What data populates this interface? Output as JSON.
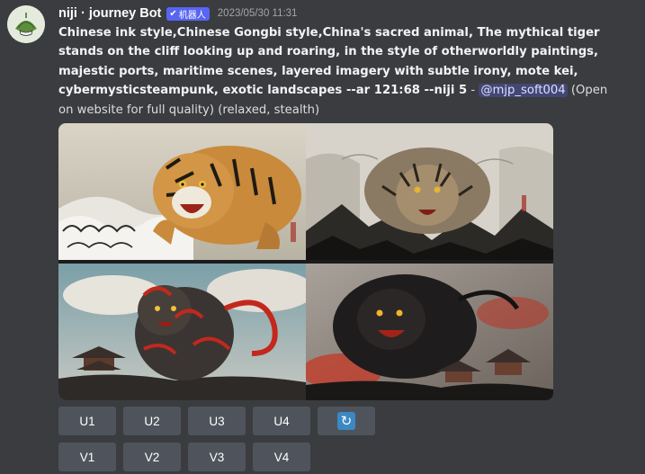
{
  "author": {
    "name": "niji · journey Bot",
    "badge_label": "机器人",
    "badge_icon": "checkmark-icon",
    "timestamp": "2023/05/30 11:31"
  },
  "message": {
    "prompt": "Chinese ink style,Chinese Gongbi style,China's sacred animal, The mythical tiger stands on the cliff looking up and roaring, in the style of otherworldly paintings, majestic ports, maritime scenes, layered imagery with subtle irony, mote kei, cybermysticsteampunk, exotic landscapes --ar 121:68 --niji 5",
    "separator": " - ",
    "mention": "@mjp_soft004",
    "suffix": " (Open on website for full quality) (relaxed, stealth)"
  },
  "image_grid": {
    "tiles": [
      "tiger-in-waves-image",
      "tiger-on-cliff-image",
      "red-tiger-temple-image",
      "black-tiger-temple-image"
    ]
  },
  "buttons": {
    "upscale": [
      "U1",
      "U2",
      "U3",
      "U4"
    ],
    "variation": [
      "V1",
      "V2",
      "V3",
      "V4"
    ],
    "reroll_icon": "reroll-icon"
  },
  "colors": {
    "background": "#3a3c3f",
    "badge": "#5865f2",
    "button": "#4f545c",
    "reroll": "#3b88c3",
    "mention_text": "#dee0fc"
  }
}
